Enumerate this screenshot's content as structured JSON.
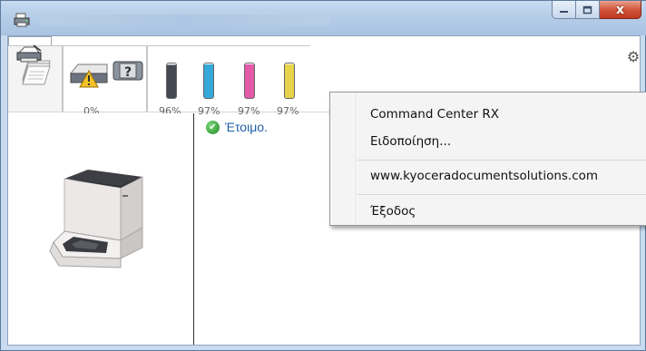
{
  "window": {
    "title": ""
  },
  "toolbar": {
    "status_tab_percent": "0%",
    "toner": [
      {
        "percent": "96%",
        "color": "#444a52",
        "level": 0.96
      },
      {
        "percent": "97%",
        "color": "#35a9d9",
        "level": 0.97
      },
      {
        "percent": "97%",
        "color": "#e35aa8",
        "level": 0.97
      },
      {
        "percent": "97%",
        "color": "#e8d44a",
        "level": 0.97
      }
    ]
  },
  "status": {
    "text": "Έτοιμο."
  },
  "menu": {
    "items": [
      {
        "label": "Command Center RX"
      },
      {
        "label": "Ειδοποίηση..."
      },
      {
        "label": "www.kyoceradocumentsolutions.com"
      },
      {
        "label": "Έξοδος"
      }
    ]
  },
  "icons": {
    "app": "printer-app-icon",
    "paper": "paper-stack-icon",
    "warning": "warning-icon",
    "unknown": "question-icon",
    "printer_menu": "printer-menu-icon",
    "settings": "gear-icon",
    "ready": "check-icon"
  }
}
